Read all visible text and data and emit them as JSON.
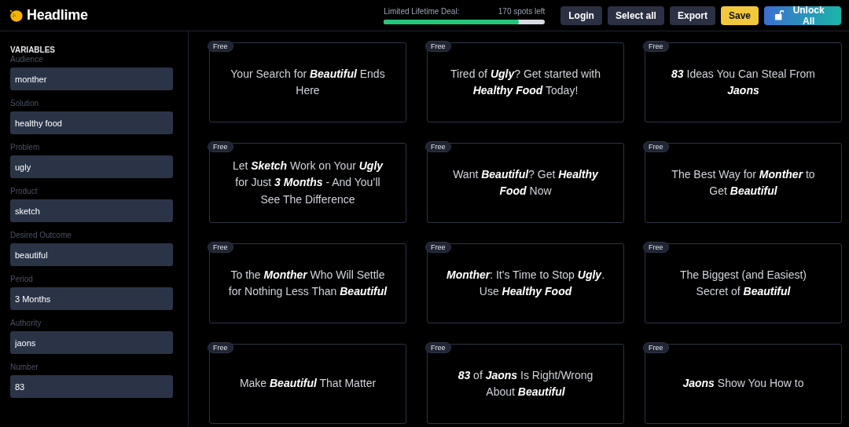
{
  "app": {
    "name": "Headlime"
  },
  "deal": {
    "label": "Limited Lifetime Deal:",
    "spots": "170 spots left",
    "level": 0.84
  },
  "buttons": [
    {
      "label": "Login",
      "kind": "plain"
    },
    {
      "label": "Select all",
      "kind": "plain"
    },
    {
      "label": "Export",
      "kind": "plain"
    },
    {
      "label": "Save",
      "kind": "save"
    },
    {
      "label": "Unlock All",
      "kind": "unlock"
    }
  ],
  "sidebar": {
    "heading": "VARIABLES",
    "fields": [
      {
        "label": "Audience",
        "value": "monther"
      },
      {
        "label": "Solution",
        "value": "healthy food"
      },
      {
        "label": "Problem",
        "value": "ugly"
      },
      {
        "label": "Product",
        "value": "sketch"
      },
      {
        "label": "Desired Outcome",
        "value": "beautiful"
      },
      {
        "label": "Period",
        "value": "3 Months"
      },
      {
        "label": "Authority",
        "value": "jaons"
      },
      {
        "label": "Number",
        "value": "83"
      }
    ]
  },
  "cards": [
    {
      "badge": "Free",
      "text": "Your Search for *Beautiful* Ends Here"
    },
    {
      "badge": "Free",
      "text": "Tired of *Ugly*? Get started with *Healthy Food* Today!"
    },
    {
      "badge": "Free",
      "text": "*83* Ideas You Can Steal From *Jaons*"
    },
    {
      "badge": "Free",
      "text": "Let *Sketch* Work on Your *Ugly* for Just *3 Months* - And You’ll See The Difference"
    },
    {
      "badge": "Free",
      "text": "Want *Beautiful*? Get *Healthy Food* Now"
    },
    {
      "badge": "Free",
      "text": "The Best Way for *Monther* to Get *Beautiful*"
    },
    {
      "badge": "Free",
      "text": "To the *Monther* Who Will Settle for Nothing Less Than *Beautiful*"
    },
    {
      "badge": "Free",
      "text": "*Monther*: It's Time to Stop *Ugly*. Use *Healthy Food*"
    },
    {
      "badge": "Free",
      "text": "The Biggest (and Easiest) Secret of *Beautiful*"
    },
    {
      "badge": "Free",
      "text": "Make *Beautiful* That Matter"
    },
    {
      "badge": "Free",
      "text": "*83* of *Jaons* Is Right/Wrong About *Beautiful*"
    },
    {
      "badge": "Free",
      "text": "*Jaons* Show You How to"
    }
  ]
}
